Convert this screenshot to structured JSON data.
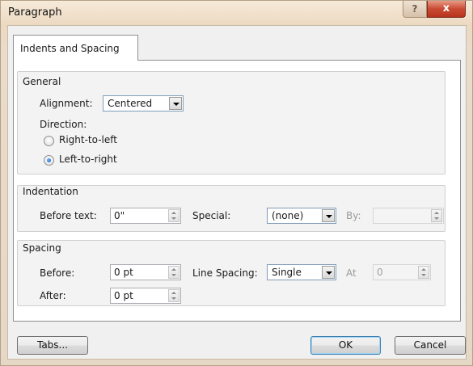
{
  "window": {
    "title": "Paragraph",
    "help_glyph": "?",
    "close_glyph": "x"
  },
  "tab": {
    "label": "Indents and Spacing"
  },
  "general": {
    "title": "General",
    "alignment_label": "Alignment:",
    "alignment_value": "Centered",
    "direction_label": "Direction:",
    "rtl_label": "Right-to-left",
    "ltr_label": "Left-to-right",
    "selected_direction": "ltr"
  },
  "indentation": {
    "title": "Indentation",
    "before_text_label": "Before text:",
    "before_text_value": "0\"",
    "special_label": "Special:",
    "special_value": "(none)",
    "by_label": "By:",
    "by_value": ""
  },
  "spacing": {
    "title": "Spacing",
    "before_label": "Before:",
    "before_value": "0 pt",
    "after_label": "After:",
    "after_value": "0 pt",
    "line_spacing_label": "Line Spacing:",
    "line_spacing_value": "Single",
    "at_label": "At",
    "at_value": "0"
  },
  "buttons": {
    "tabs": "Tabs...",
    "ok": "OK",
    "cancel": "Cancel"
  },
  "colors": {
    "close_red": "#c94a32",
    "frame": "#ecd9c2",
    "default_button_border": "#3c7fb1"
  }
}
